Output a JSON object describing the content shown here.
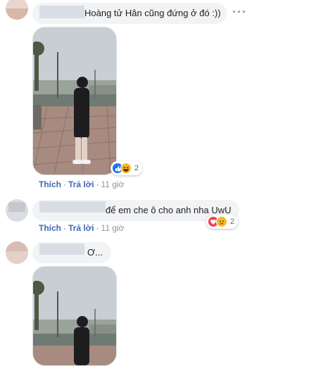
{
  "comments": [
    {
      "text": "Hoàng tử Hân cũng đứng ở đó :))",
      "more_label": "···",
      "actions": {
        "like": "Thích",
        "reply": "Trả lời",
        "time": "11 giờ"
      },
      "reactions": {
        "icons": [
          "like-icon",
          "haha-icon"
        ],
        "count": "2"
      }
    },
    {
      "text": "để em che ô cho anh nha UwU",
      "actions": {
        "like": "Thích",
        "reply": "Trả lời",
        "time": "11 giờ"
      },
      "reactions": {
        "icons": [
          "love-icon",
          "sad-icon"
        ],
        "count": "2"
      }
    },
    {
      "text": "Ơ..."
    }
  ],
  "colors": {
    "bubble": "#f2f3f5",
    "link": "#4267b2",
    "meta": "#90949c",
    "like": "#1877f2",
    "love": "#f33e58",
    "haha": "#f7b928"
  }
}
